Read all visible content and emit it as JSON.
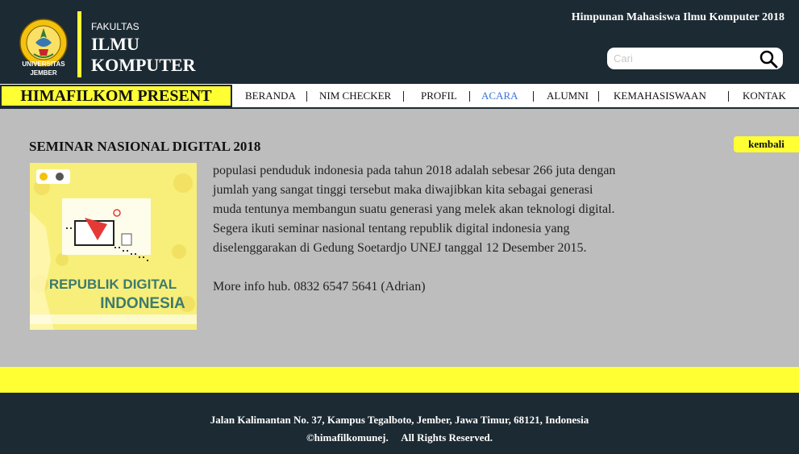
{
  "header": {
    "logo_caption": [
      "UNIVERSITAS",
      "JEMBER"
    ],
    "faculty_small": "FAKULTAS",
    "faculty_big": [
      "ILMU",
      "KOMPUTER"
    ],
    "org_title": "Himpunan Mahasiswa Ilmu Komputer 2018",
    "search_placeholder": "Cari"
  },
  "nav": {
    "brand": "HIMAFILKOM PRESENT",
    "items": [
      {
        "label": "BERANDA",
        "active": false
      },
      {
        "label": "NIM CHECKER",
        "active": false
      },
      {
        "label": "PROFIL",
        "active": false
      },
      {
        "label": "ACARA",
        "active": true
      },
      {
        "label": "ALUMNI",
        "active": false
      },
      {
        "label": "KEMAHASISWAAN",
        "active": false
      },
      {
        "label": "KONTAK",
        "active": false
      }
    ]
  },
  "main": {
    "title": "SEMINAR NASIONAL DIGITAL 2018",
    "back_label": "kembali",
    "poster": {
      "line1": "REPUBLIK DIGITAL",
      "line2": "INDONESIA"
    },
    "body": "populasi penduduk indonesia pada tahun 2018 adalah sebesar 266 juta dengan jumlah yang sangat tinggi tersebut maka diwajibkan kita sebagai generasi muda tentunya  membangun suatu generasi yang melek akan teknologi digital. Segera ikuti seminar nasional  tentang republik digital indonesia yang diselenggarakan di Gedung Soetardjo UNEJ tanggal 12 Desember 2015.",
    "info": "More info hub. 0832 6547 5641 (Adrian)"
  },
  "footer": {
    "address": "Jalan Kalimantan No. 37, Kampus Tegalboto, Jember, Jawa Timur, 68121, Indonesia",
    "copyright": "©himafilkomunej.     All Rights Reserved."
  },
  "colors": {
    "dark": "#1c2a33",
    "yellow": "#ffff33",
    "active_link": "#3b73d8",
    "content_bg": "#bdbdbd"
  }
}
